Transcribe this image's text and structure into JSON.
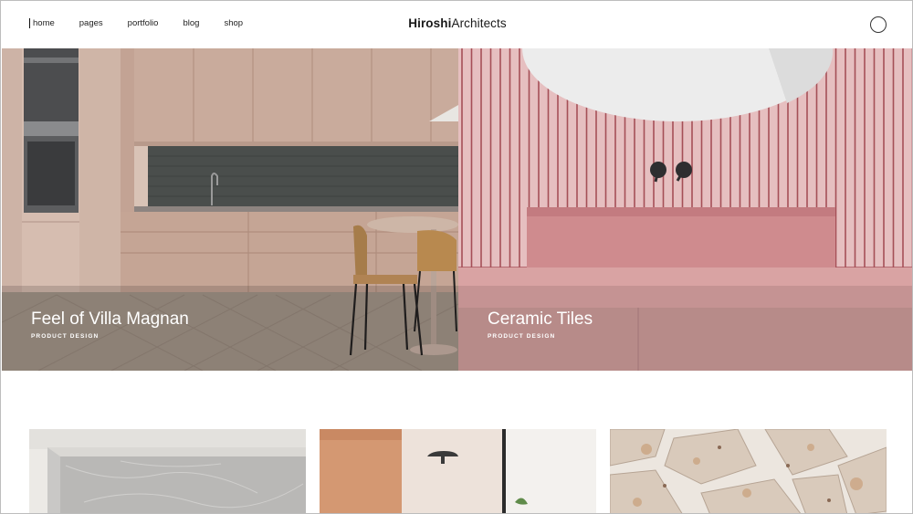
{
  "header": {
    "nav": [
      {
        "label": "home",
        "active": true
      },
      {
        "label": "pages"
      },
      {
        "label": "portfolio"
      },
      {
        "label": "blog"
      },
      {
        "label": "shop"
      }
    ],
    "logo_bold": "Hiroshi",
    "logo_regular": "Architects",
    "user_icon": "user-circle-icon"
  },
  "hero": [
    {
      "title": "Feel of Villa Magnan",
      "category": "PRODUCT DESIGN"
    },
    {
      "title": "Ceramic Tiles",
      "category": "PRODUCT DESIGN"
    }
  ],
  "colors": {
    "kitchen_cabinet": "#c9ab9c",
    "kitchen_backsplash": "#4a4e4c",
    "tile_pink": "#e6bfc0",
    "tile_grout": "#a54f57",
    "basin": "#cf8b8e",
    "text_dark": "#1a1a1a"
  }
}
